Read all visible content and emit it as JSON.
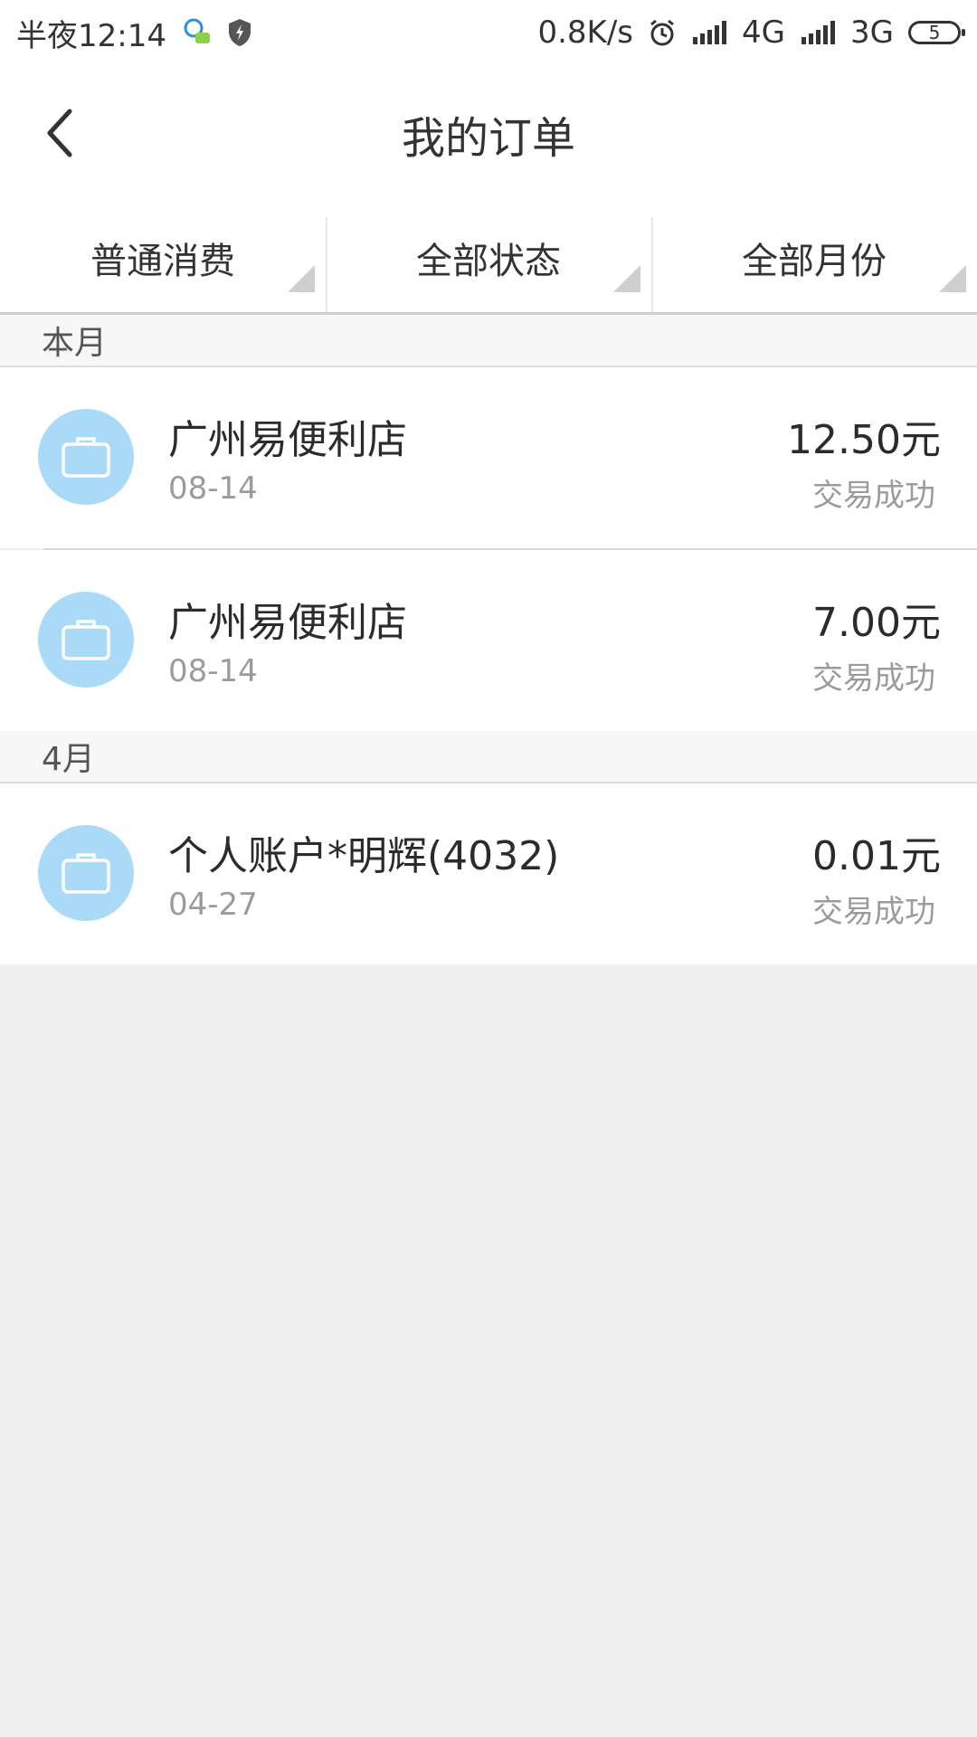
{
  "status_bar": {
    "time": "半夜12:14",
    "net_speed": "0.8K/s",
    "net1": "4G",
    "net2": "3G",
    "battery": "5"
  },
  "header": {
    "title": "我的订单"
  },
  "filters": [
    {
      "label": "普通消费"
    },
    {
      "label": "全部状态"
    },
    {
      "label": "全部月份"
    }
  ],
  "sections": [
    {
      "title": "本月",
      "orders": [
        {
          "name": "广州易便利店",
          "date": "08-14",
          "amount": "12.50元",
          "status": "交易成功"
        },
        {
          "name": "广州易便利店",
          "date": "08-14",
          "amount": "7.00元",
          "status": "交易成功"
        }
      ]
    },
    {
      "title": "4月",
      "orders": [
        {
          "name": "个人账户*明辉(4032)",
          "date": "04-27",
          "amount": "0.01元",
          "status": "交易成功"
        }
      ]
    }
  ],
  "icons": {
    "back": "chevron-left-icon",
    "order": "bag-icon",
    "alarm": "alarm-icon",
    "signal": "signal-icon",
    "qq": "qq-icon",
    "shield": "shield-icon"
  },
  "colors": {
    "avatar_bg": "#a9dbf8",
    "page_bg": "#efefef"
  }
}
